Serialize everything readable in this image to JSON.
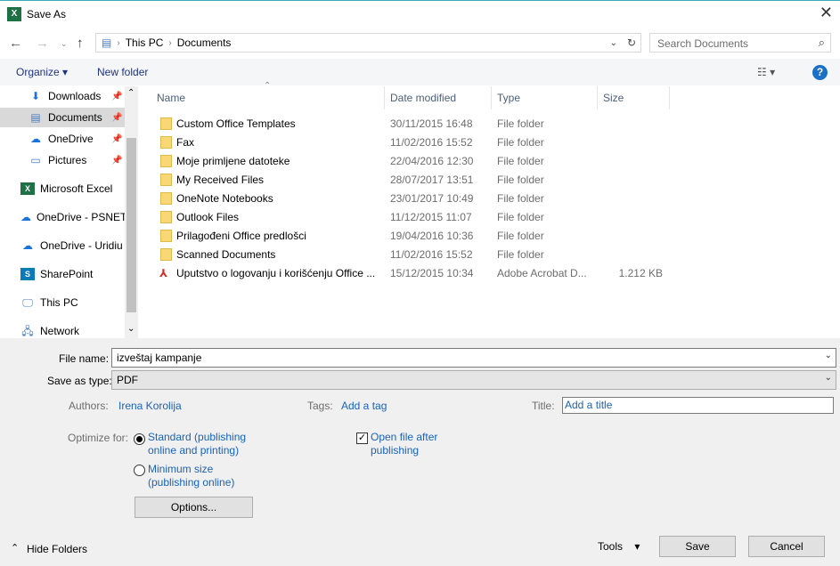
{
  "window": {
    "title": "Save As",
    "app_icon": "excel-icon"
  },
  "address": {
    "path": [
      "This PC",
      "Documents"
    ],
    "search_placeholder": "Search Documents"
  },
  "toolbar": {
    "organize": "Organize",
    "new_folder": "New folder",
    "help": "?"
  },
  "sidebar": {
    "items": [
      {
        "label": "Downloads",
        "icon": "download-arrow-icon",
        "pinned": true
      },
      {
        "label": "Documents",
        "icon": "documents-icon",
        "pinned": true,
        "selected": true
      },
      {
        "label": "OneDrive",
        "icon": "onedrive-cloud-icon",
        "pinned": true
      },
      {
        "label": "Pictures",
        "icon": "pictures-icon",
        "pinned": true
      },
      {
        "label": "Microsoft Excel",
        "icon": "excel-icon"
      },
      {
        "label": "OneDrive - PSNET",
        "icon": "onedrive-cloud-icon"
      },
      {
        "label": "OneDrive - Uridiu",
        "icon": "onedrive-cloud-icon"
      },
      {
        "label": "SharePoint",
        "icon": "sharepoint-icon"
      },
      {
        "label": "This PC",
        "icon": "computer-icon"
      },
      {
        "label": "Network",
        "icon": "network-icon"
      }
    ]
  },
  "columns": [
    "Name",
    "Date modified",
    "Type",
    "Size"
  ],
  "files": [
    {
      "name": "Custom Office Templates",
      "date": "30/11/2015 16:48",
      "type": "File folder",
      "size": ""
    },
    {
      "name": "Fax",
      "date": "11/02/2016 15:52",
      "type": "File folder",
      "size": ""
    },
    {
      "name": "Moje primljene datoteke",
      "date": "22/04/2016 12:30",
      "type": "File folder",
      "size": ""
    },
    {
      "name": "My Received Files",
      "date": "28/07/2017 13:51",
      "type": "File folder",
      "size": ""
    },
    {
      "name": "OneNote Notebooks",
      "date": "23/01/2017 10:49",
      "type": "File folder",
      "size": ""
    },
    {
      "name": "Outlook Files",
      "date": "11/12/2015 11:07",
      "type": "File folder",
      "size": ""
    },
    {
      "name": "Prilagođeni Office predlošci",
      "date": "19/04/2016 10:36",
      "type": "File folder",
      "size": ""
    },
    {
      "name": "Scanned Documents",
      "date": "11/02/2016 15:52",
      "type": "File folder",
      "size": ""
    },
    {
      "name": "Uputstvo o logovanju i korišćenju Office ...",
      "date": "15/12/2015 10:34",
      "type": "Adobe Acrobat D...",
      "size": "1.212 KB"
    }
  ],
  "form": {
    "file_name_label": "File name:",
    "file_name": "izveštaj kampanje",
    "type_label": "Save as type:",
    "type": "PDF",
    "authors_label": "Authors:",
    "authors": "Irena Korolija",
    "tags_label": "Tags:",
    "tags_placeholder": "Add a tag",
    "title_label": "Title:",
    "title_placeholder": "Add a title",
    "optimize_label": "Optimize for:",
    "opt_standard": "Standard (publishing online and printing)",
    "opt_minimum": "Minimum size (publishing online)",
    "open_after": "Open file after publishing",
    "open_after_checked": true,
    "options": "Options..."
  },
  "footer": {
    "hide_folders": "Hide Folders",
    "tools": "Tools",
    "save": "Save",
    "cancel": "Cancel"
  }
}
